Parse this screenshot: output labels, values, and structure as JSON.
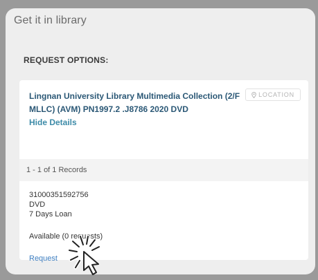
{
  "card": {
    "title": "Get it in library"
  },
  "request_options": {
    "heading": "REQUEST OPTIONS:"
  },
  "holding": {
    "location_text": "Lingnan University Library  Multimedia Collection (2/F MLLC)  (AVM) PN1997.2 .J8786 2020 DVD",
    "hide_details": "Hide Details",
    "location_button": "LOCATION",
    "location_button_icon": "map-pin-icon",
    "records_label": "1 - 1 of 1 Records",
    "item": {
      "barcode": "31000351592756",
      "type": "DVD",
      "loan_policy": "7 Days Loan",
      "availability": "Available (0 requests)",
      "request_link": "Request"
    }
  },
  "cursor": {
    "icon": "pointer-cursor-click-icon"
  }
}
